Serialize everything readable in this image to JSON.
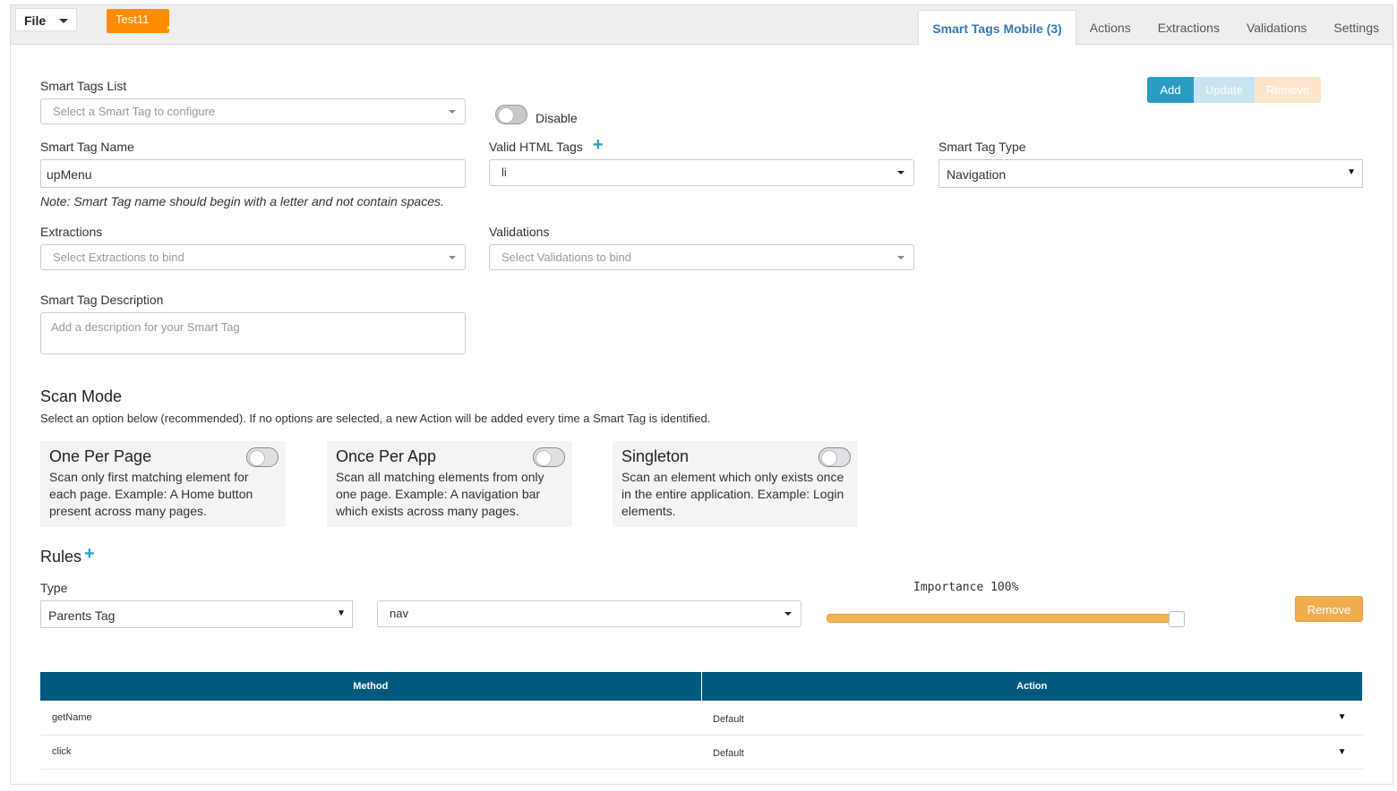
{
  "topbar": {
    "file_label": "File",
    "project_name": "Test11",
    "project_modified_mark": "*",
    "tabs": [
      {
        "label": "Smart Tags Mobile (3)",
        "active": true
      },
      {
        "label": "Actions",
        "active": false
      },
      {
        "label": "Extractions",
        "active": false
      },
      {
        "label": "Validations",
        "active": false
      },
      {
        "label": "Settings",
        "active": false
      }
    ]
  },
  "form": {
    "smart_tags_list_label": "Smart Tags List",
    "smart_tags_list_placeholder": "Select a Smart Tag to configure",
    "disable_label": "Disable",
    "disable_on": false,
    "name_label": "Smart Tag Name",
    "name_value": "upMenu",
    "name_note": "Note: Smart Tag name should begin with a letter and not contain spaces.",
    "valid_html_label": "Valid HTML Tags",
    "valid_html_value": "li",
    "type_label": "Smart Tag Type",
    "type_value": "Navigation",
    "extractions_label": "Extractions",
    "extractions_placeholder": "Select Extractions to bind",
    "validations_label": "Validations",
    "validations_placeholder": "Select Validations to bind",
    "description_label": "Smart Tag Description",
    "description_placeholder": "Add a description for your Smart Tag"
  },
  "actions": {
    "add": "Add",
    "update": "Update",
    "remove": "Remove"
  },
  "scan_mode": {
    "title": "Scan Mode",
    "description": "Select an option below (recommended). If no options are selected, a new Action will be added every time a Smart Tag is identified.",
    "options": [
      {
        "title": "One Per Page",
        "text": "Scan only first matching element for each page. Example: A Home button present across many pages.",
        "on": false
      },
      {
        "title": "Once Per App",
        "text": "Scan all matching elements from only one page. Example: A navigation bar which exists across many pages.",
        "on": false
      },
      {
        "title": "Singleton",
        "text": "Scan an element which only exists once in the entire application. Example: Login elements.",
        "on": false
      }
    ]
  },
  "rules": {
    "title": "Rules",
    "type_label": "Type",
    "type_value": "Parents Tag",
    "tag_value": "nav",
    "importance_label": "Importance 100%",
    "importance_fraction": 1.0,
    "remove_label": "Remove"
  },
  "methods_table": {
    "headers": [
      "Method",
      "Action"
    ],
    "rows": [
      {
        "method": "getName",
        "action": "Default"
      },
      {
        "method": "click",
        "action": "Default"
      }
    ]
  }
}
